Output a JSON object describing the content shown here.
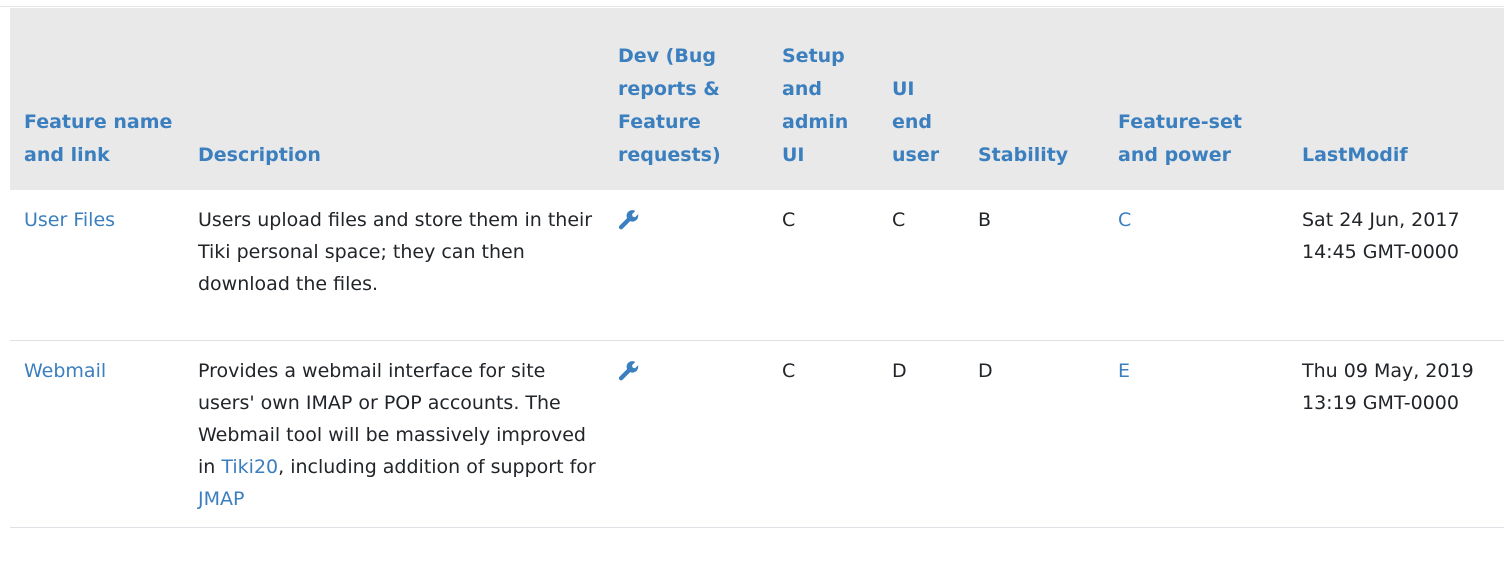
{
  "columns": [
    "Feature name and link",
    "Description",
    "Dev (Bug reports & Feature requests)",
    "Setup and admin UI",
    "UI end user",
    "Stability",
    "Feature-set and power",
    "LastModif"
  ],
  "rows": [
    {
      "feature": "User Files",
      "description": "Users upload files and store them in their Tiki personal space; they can then download the files.",
      "dev_icon": "wrench-icon",
      "setup": "C",
      "ui_end_user": "C",
      "stability": "B",
      "feature_set": "C",
      "last_modif": "Sat 24 Jun, 2017 14:45 GMT-0000"
    },
    {
      "feature": "Webmail",
      "description_part1": "Provides a webmail interface for site users' own IMAP or POP accounts. The Webmail tool will be massively improved in ",
      "description_link1": "Tiki20",
      "description_part2": ", including addition of support for ",
      "description_link2": "JMAP",
      "dev_icon": "wrench-icon",
      "setup": "C",
      "ui_end_user": "D",
      "stability": "D",
      "feature_set": "E",
      "last_modif": "Thu 09 May, 2019 13:19 GMT-0000"
    }
  ],
  "colors": {
    "link": "#3b7fbf",
    "header_bg": "#e9e9e9",
    "text": "#212529"
  }
}
